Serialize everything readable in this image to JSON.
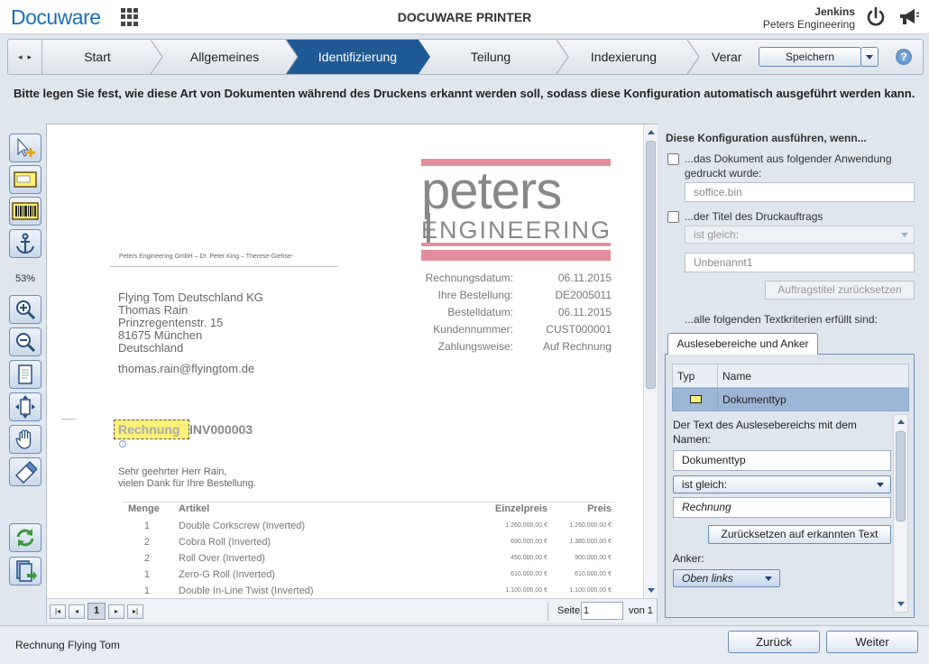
{
  "header": {
    "logo": "Docuware",
    "title": "DOCUWARE PRINTER",
    "user_name": "Jenkins",
    "user_org": "Peters Engineering"
  },
  "steps": {
    "items": [
      {
        "label": "Start",
        "active": false
      },
      {
        "label": "Allgemeines",
        "active": false
      },
      {
        "label": "Identifizierung",
        "active": true
      },
      {
        "label": "Teilung",
        "active": false
      },
      {
        "label": "Indexierung",
        "active": false
      },
      {
        "label": "Verar",
        "active": false
      }
    ],
    "save_label": "Speichern",
    "help_label": "?",
    "scroll_left": "◂",
    "scroll_right": "▸"
  },
  "instruction": "Bitte legen Sie fest, wie diese Art von Dokumenten während des Druckens erkannt werden soll, sodass diese Konfiguration automatisch ausgeführt werden kann.",
  "toolbar": {
    "zoom": "53%",
    "tools": [
      "select-area-tool-icon",
      "text-area-tool-icon",
      "barcode-tool-icon",
      "anchor-tool-icon",
      "zoom-in-icon",
      "zoom-out-icon",
      "fit-page-icon",
      "fit-width-icon",
      "pan-hand-icon",
      "eraser-icon",
      "refresh-icon",
      "export-document-icon"
    ]
  },
  "document": {
    "brand_top": "peters",
    "brand_bottom": "ENGINEERING",
    "sender": "Peters Engineering GmbH – Dr. Peter King – Therese-Giehse-",
    "address": [
      "Flying Tom Deutschland KG",
      "Thomas Rain",
      "Prinzregentenstr. 15",
      "81675 München",
      "Deutschland"
    ],
    "email": "thomas.rain@flyingtom.de",
    "meta": [
      {
        "key": "Rechnungsdatum:",
        "value": "06.11.2015"
      },
      {
        "key": "Ihre Bestellung:",
        "value": "DE2005011"
      },
      {
        "key": "Bestelldatum:",
        "value": "06.11.2015"
      },
      {
        "key": "Kundennummer:",
        "value": "CUST000001"
      },
      {
        "key": "Zahlungsweise:",
        "value": "Auf Rechnung"
      }
    ],
    "doc_type_label": "Rechnung",
    "invoice_number": "INV000003",
    "info_glyph": "i",
    "greeting": [
      "Sehr geehrter Herr Rain,",
      "vielen Dank für Ihre Bestellung."
    ],
    "table": {
      "headers": [
        "Menge",
        "Artikel",
        "Einzelpreis",
        "Preis"
      ],
      "rows": [
        [
          "1",
          "Double Corkscrew (Inverted)",
          "1.260.000,00 €",
          "1.260.000,00 €"
        ],
        [
          "2",
          "Cobra Roll (Inverted)",
          "690.000,00 €",
          "1.380.000,00 €"
        ],
        [
          "2",
          "Roll Over (Inverted)",
          "450.000,00 €",
          "900.000,00 €"
        ],
        [
          "1",
          "Zero-G Roll (Inverted)",
          "610.000,00 €",
          "610.000,00 €"
        ],
        [
          "1",
          "Double In-Line Twist (Inverted)",
          "1.100.000,00 €",
          "1.100.000,00 €"
        ]
      ]
    }
  },
  "pager": {
    "first": "|◂",
    "prev": "◂",
    "current": "1",
    "next": "▸",
    "last": "▸|",
    "page_label": "Seite",
    "page_value": "1",
    "of_label": "von 1"
  },
  "panel": {
    "title": "Diese Konfiguration ausführen, wenn...",
    "app_condition": "...das Dokument aus folgender Anwendung gedruckt wurde:",
    "app_value": "soffice.bin",
    "title_condition": "...der Titel des Druckauftrags",
    "title_operator": "ist gleich:",
    "title_value": "Unbenannt1",
    "reset_title_button": "Auftragstitel zurücksetzen",
    "text_criteria": "...alle folgenden Textkriterien erfüllt sind:",
    "tab_label": "Auslesebereiche und Anker",
    "grid": {
      "col_type": "Typ",
      "col_name": "Name",
      "row_name": "Dokumenttyp"
    },
    "detail": {
      "description": "Der Text des Auslesebereichs mit dem Namen:",
      "area_name": "Dokumenttyp",
      "operator": "ist gleich:",
      "value": "Rechnung",
      "reset_button": "Zurücksetzen auf erkannten Text",
      "anchor_label": "Anker:",
      "anchor_value": "Oben links"
    }
  },
  "footer": {
    "status": "Rechnung Flying Tom",
    "back_button": "Zurück",
    "next_button": "Weiter"
  }
}
